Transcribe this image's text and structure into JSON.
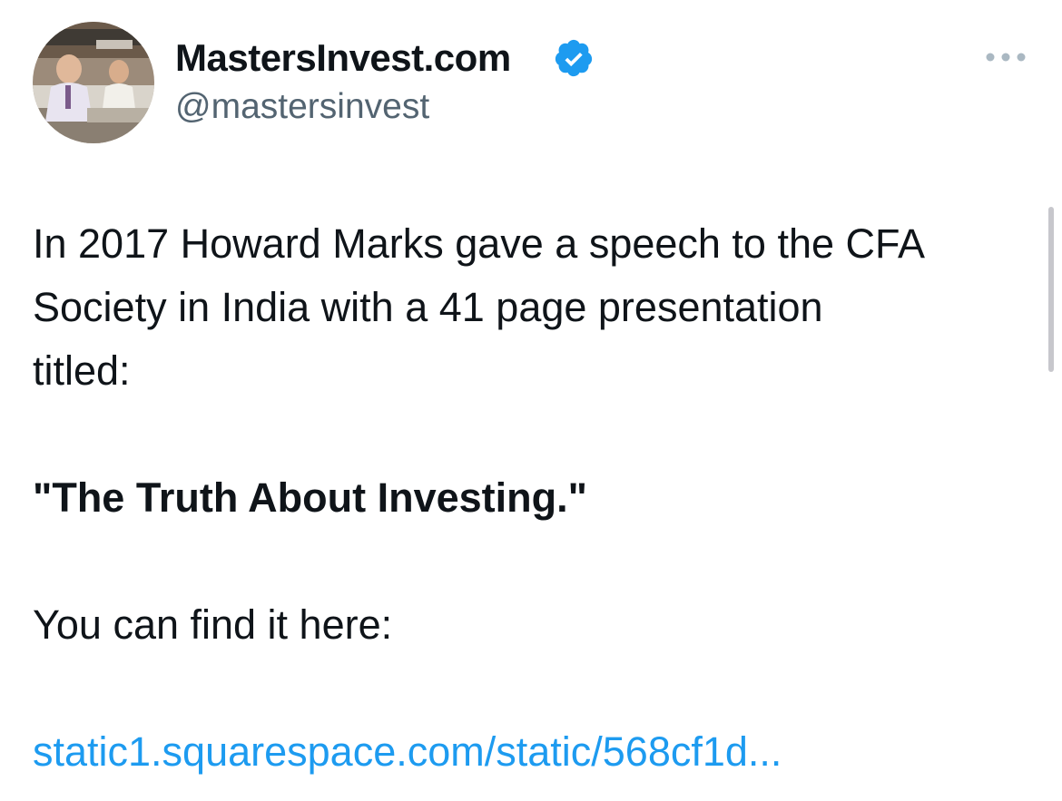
{
  "author": {
    "display_name": "MastersInvest.com",
    "handle": "@mastersinvest",
    "verified": true,
    "avatar": "avatar-trading-floor-photo"
  },
  "tweet": {
    "line1": "In 2017 Howard Marks gave a speech to the CFA",
    "line2": "Society in India with a 41 page presentation",
    "line3": "titled:",
    "title_quote": "\"The Truth About Investing.\"",
    "find_text": "You can find it here:",
    "link_text": "static1.squarespace.com/static/568cf1d..."
  },
  "icons": {
    "verified": "verified-badge-icon",
    "more": "more-options-icon"
  },
  "colors": {
    "link": "#1d9bf0",
    "verified": "#1d9bf0",
    "text": "#0f1419",
    "secondary_text": "#536471"
  }
}
